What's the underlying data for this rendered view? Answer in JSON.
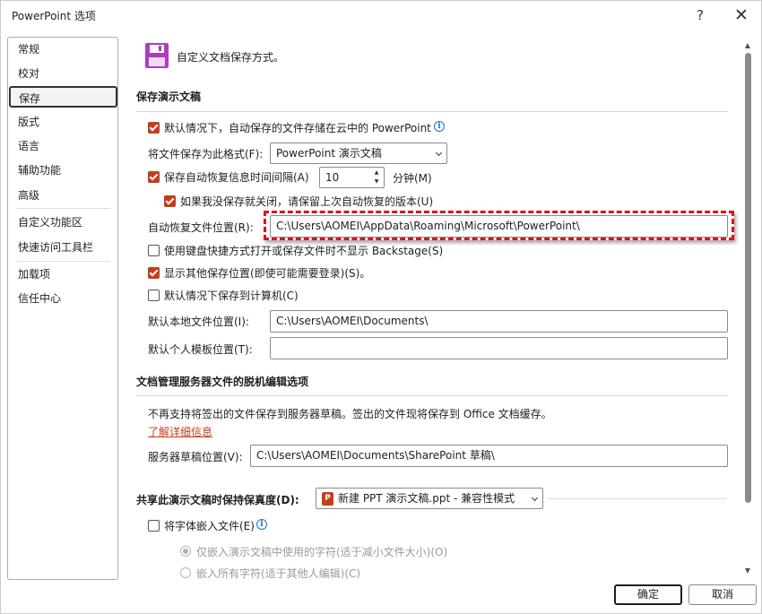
{
  "window": {
    "title": "PowerPoint 选项",
    "help_label": "?",
    "close_label": "✕"
  },
  "nav": {
    "items": [
      {
        "label": "常规"
      },
      {
        "label": "校对"
      },
      {
        "label": "保存",
        "selected": true
      },
      {
        "label": "版式"
      },
      {
        "label": "语言"
      },
      {
        "label": "辅助功能"
      },
      {
        "label": "高级"
      },
      {
        "label": "自定义功能区"
      },
      {
        "label": "快速访问工具栏"
      },
      {
        "label": "加载项"
      },
      {
        "label": "信任中心"
      }
    ]
  },
  "header": {
    "icon": "save-floppy-icon",
    "text": "自定义文档保存方式。"
  },
  "save_presentations": {
    "title": "保存演示文稿",
    "autosave_cloud": {
      "checked": true,
      "label": "默认情况下，自动保存的文件存储在云中的 PowerPoint"
    },
    "save_format": {
      "label": "将文件保存为此格式(F):",
      "value": "PowerPoint 演示文稿"
    },
    "autorecover_interval": {
      "checked": true,
      "label": "保存自动恢复信息时间间隔(A)",
      "value": "10",
      "unit": "分钟(M)"
    },
    "keep_last_autorecover": {
      "checked": true,
      "label": "如果我没保存就关闭，请保留上次自动恢复的版本(U)"
    },
    "autorecover_location": {
      "label": "自动恢复文件位置(R):",
      "value": "C:\\Users\\AOMEI\\AppData\\Roaming\\Microsoft\\PowerPoint\\"
    },
    "no_backstage": {
      "checked": false,
      "label": "使用键盘快捷方式打开或保存文件时不显示 Backstage(S)"
    },
    "show_other_locations": {
      "checked": true,
      "label": "显示其他保存位置(即使可能需要登录)(S)。"
    },
    "save_to_computer": {
      "checked": false,
      "label": "默认情况下保存到计算机(C)"
    },
    "default_local_location": {
      "label": "默认本地文件位置(I):",
      "value": "C:\\Users\\AOMEI\\Documents\\"
    },
    "default_template_location": {
      "label": "默认个人模板位置(T):",
      "value": ""
    }
  },
  "offline_editing": {
    "title": "文档管理服务器文件的脱机编辑选项",
    "notice": "不再支持将签出的文件保存到服务器草稿。签出的文件现将保存到 Office 文档缓存。",
    "learn_more": "了解详细信息",
    "drafts_location": {
      "label": "服务器草稿位置(V):",
      "value": "C:\\Users\\AOMEI\\Documents\\SharePoint 草稿\\"
    }
  },
  "fidelity": {
    "title": "共享此演示文稿时保持保真度(D):",
    "presentation": "新建 PPT 演示文稿.ppt  -  兼容性模式",
    "embed_fonts": {
      "checked": false,
      "label": "将字体嵌入文件(E)"
    },
    "embed_used_only": {
      "selected": true,
      "label": "仅嵌入演示文稿中使用的字符(适于减小文件大小)(O)"
    },
    "embed_all": {
      "selected": false,
      "label": "嵌入所有字符(适于其他人编辑)(C)"
    }
  },
  "footer": {
    "ok_label": "确定",
    "cancel_label": "取消"
  },
  "colors": {
    "accent": "#c43e1c",
    "highlight_frame": "#d9141c",
    "info": "#1a73c9"
  }
}
